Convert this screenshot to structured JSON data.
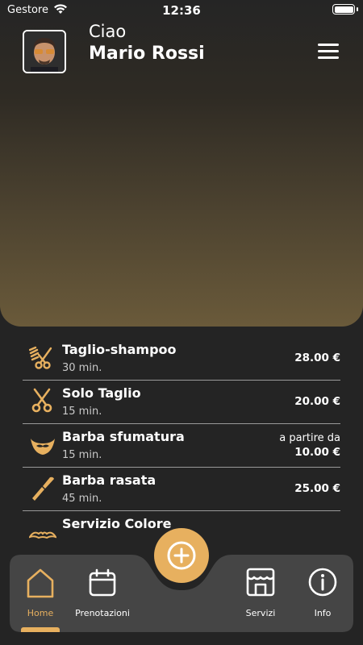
{
  "status": {
    "carrier": "Gestore",
    "time": "12:36"
  },
  "header": {
    "greeting": "Ciao",
    "name": "Mario Rossi"
  },
  "services": [
    {
      "name": "Taglio-shampoo",
      "duration": "30 min.",
      "price": "28.00 €",
      "icon": "scissors-comb-icon"
    },
    {
      "name": "Solo Taglio",
      "duration": "15 min.",
      "price": "20.00 €",
      "icon": "scissors-icon"
    },
    {
      "name": "Barba sfumatura",
      "duration": "15 min.",
      "price_prefix": "a partire da",
      "price": "10.00 €",
      "icon": "beard-mustache-icon"
    },
    {
      "name": "Barba rasata",
      "duration": "45 min.",
      "price": "25.00 €",
      "icon": "razor-icon"
    },
    {
      "name": "Servizio Colore",
      "icon": "mustache-icon"
    }
  ],
  "nav": {
    "home": "Home",
    "bookings": "Prenotazioni",
    "services": "Servizi",
    "info": "Info"
  },
  "colors": {
    "accent": "#e7b05f",
    "background": "#242424",
    "bar": "#454545"
  }
}
